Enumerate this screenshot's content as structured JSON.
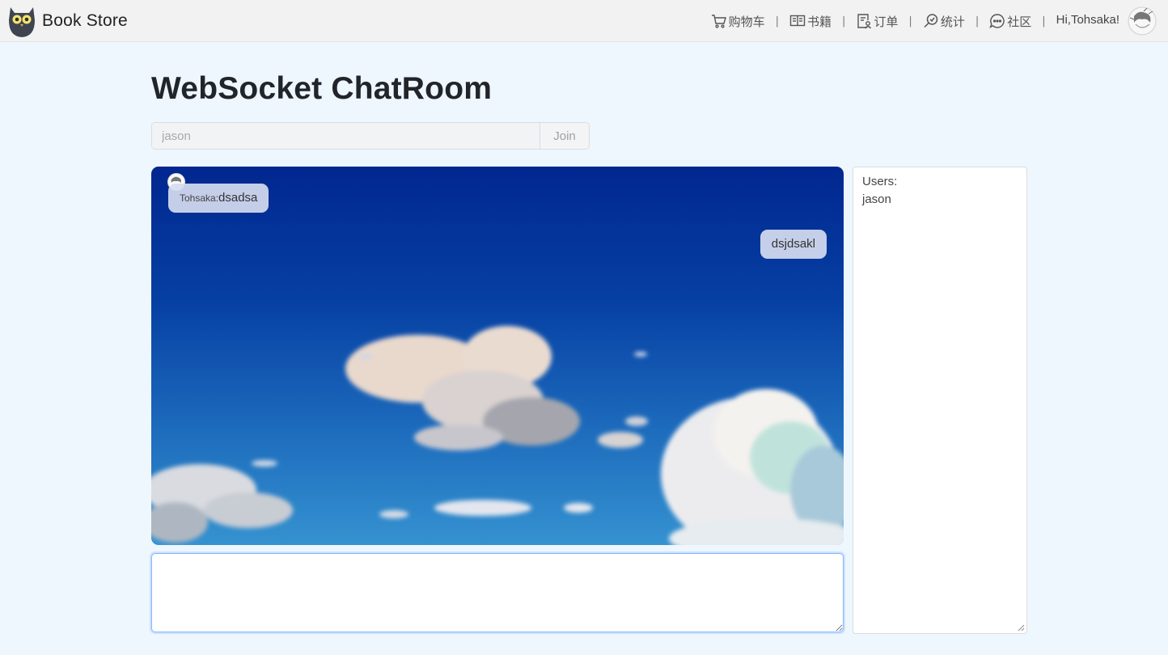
{
  "header": {
    "brand": "Book Store",
    "nav": [
      {
        "label": "购物车",
        "icon": "cart-icon"
      },
      {
        "label": "书籍",
        "icon": "book-icon"
      },
      {
        "label": "订单",
        "icon": "order-icon"
      },
      {
        "label": "统计",
        "icon": "stats-icon"
      },
      {
        "label": "社区",
        "icon": "chat-bubble-icon"
      }
    ],
    "separator": "|",
    "greeting": "Hi,Tohsaka!"
  },
  "page": {
    "title": "WebSocket ChatRoom"
  },
  "join": {
    "placeholder": "jason",
    "button_label": "Join"
  },
  "chat": {
    "messages": [
      {
        "sender": "Tohsaka:",
        "text": "dsadsa",
        "side": "left"
      },
      {
        "text": "dsjdsakl",
        "side": "right"
      }
    ]
  },
  "message_input": {
    "value": ""
  },
  "users": {
    "label": "Users:",
    "list": [
      "jason"
    ]
  },
  "colors": {
    "page_bg": "#eef6fe",
    "header_bg": "#f2f2f2",
    "sky_top": "#01278f",
    "sky_bottom": "#2f86c8",
    "bubble": "#d6dcf0",
    "focus_border": "#86b7fe"
  }
}
